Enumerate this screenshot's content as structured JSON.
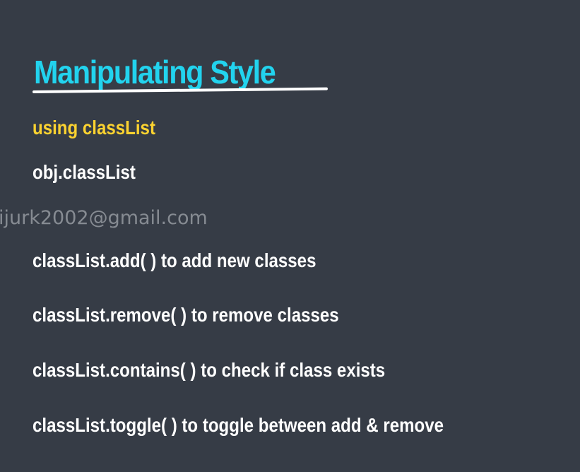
{
  "slide": {
    "title": "Manipulating Style",
    "subtitle": "using classList",
    "lines": [
      "obj.classList",
      "classList.add( ) to add new classes",
      "classList.remove( ) to remove classes",
      "classList.contains( ) to check if class exists",
      "classList.toggle( ) to toggle between add & remove"
    ],
    "watermark": "ijurk2002@gmail.com"
  },
  "colors": {
    "background": "#363c46",
    "title": "#22d3ee",
    "subtitle": "#fbd230",
    "body_text": "#ffffff"
  }
}
